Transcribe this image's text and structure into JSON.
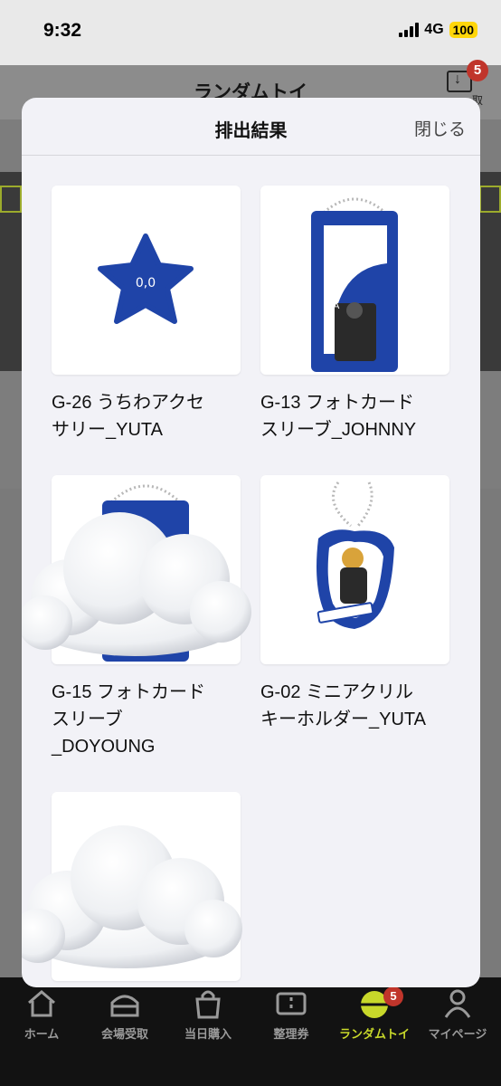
{
  "status": {
    "time": "9:32",
    "network": "4G",
    "battery": "100"
  },
  "app": {
    "title": "ランダムトイ",
    "inbox_badge": "5",
    "inbox_label": "取"
  },
  "modal": {
    "title": "排出結果",
    "close_label": "閉じる",
    "items": [
      {
        "caption": "G-26 うちわアクセ\nサリー_YUTA"
      },
      {
        "caption": "G-13 フォトカード\nスリーブ_JOHNNY"
      },
      {
        "caption": "G-15 フォトカード\nスリーブ\n_DOYOUNG"
      },
      {
        "caption": "G-02 ミニアクリル\nキーホルダー_YUTA"
      },
      {
        "caption": ""
      }
    ]
  },
  "tabs": [
    {
      "label": "ホーム",
      "icon": "home-icon"
    },
    {
      "label": "会場受取",
      "icon": "venue-pickup-icon"
    },
    {
      "label": "当日購入",
      "icon": "shopping-bag-icon"
    },
    {
      "label": "整理券",
      "icon": "ticket-icon"
    },
    {
      "label": "ランダムトイ",
      "icon": "random-toy-icon",
      "badge": "5",
      "active": true
    },
    {
      "label": "マイページ",
      "icon": "person-icon"
    }
  ],
  "colors": {
    "accent": "#c8d82a",
    "badge": "#c0352b",
    "item_blue": "#1f44a8"
  }
}
